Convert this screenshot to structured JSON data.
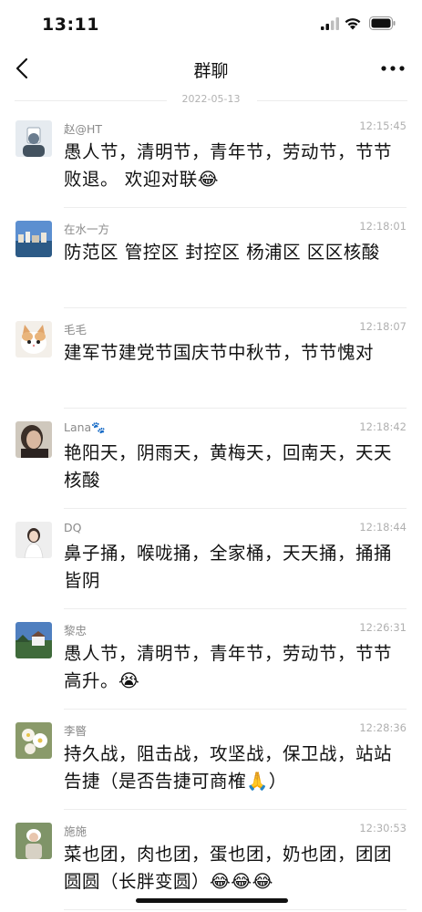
{
  "status_bar": {
    "time": "13:11"
  },
  "nav": {
    "title": "群聊"
  },
  "date_divider": "2022-05-13",
  "messages": [
    {
      "name": "赵@HT",
      "time": "12:15:45",
      "text": "愚人节，清明节，青年节，劳动节，节节败退。 欢迎对联😂"
    },
    {
      "name": "在水一方",
      "time": "12:18:01",
      "text": "防范区 管控区 封控区 杨浦区 区区核酸"
    },
    {
      "name": "毛毛",
      "time": "12:18:07",
      "text": "建军节建党节国庆节中秋节，节节愧对"
    },
    {
      "name": "Lana🐾",
      "time": "12:18:42",
      "text": "艳阳天，阴雨天，黄梅天，回南天，天天核酸"
    },
    {
      "name": "DQ",
      "time": "12:18:44",
      "text": "鼻子捅，喉咙捅，全家桶，天天捅，捅捅皆阴"
    },
    {
      "name": "黎忠",
      "time": "12:26:31",
      "text": "愚人节，清明节，青年节，劳动节，节节高升。😭"
    },
    {
      "name": "李暋",
      "time": "12:28:36",
      "text": "持久战，阻击战，攻坚战，保卫战，站站告捷（是否告捷可商榷🙏）"
    },
    {
      "name": "施施",
      "time": "12:30:53",
      "text": "菜也团，肉也团，蛋也团，奶也团，团团圆圆（长胖变圆）😂😂😂"
    }
  ],
  "icons": {
    "back": "chevron-left-icon",
    "more": "more-dots-icon"
  },
  "colors": {
    "name": "#8a8a8a",
    "timestamp": "#b0b0b0",
    "divider": "#ededed"
  }
}
